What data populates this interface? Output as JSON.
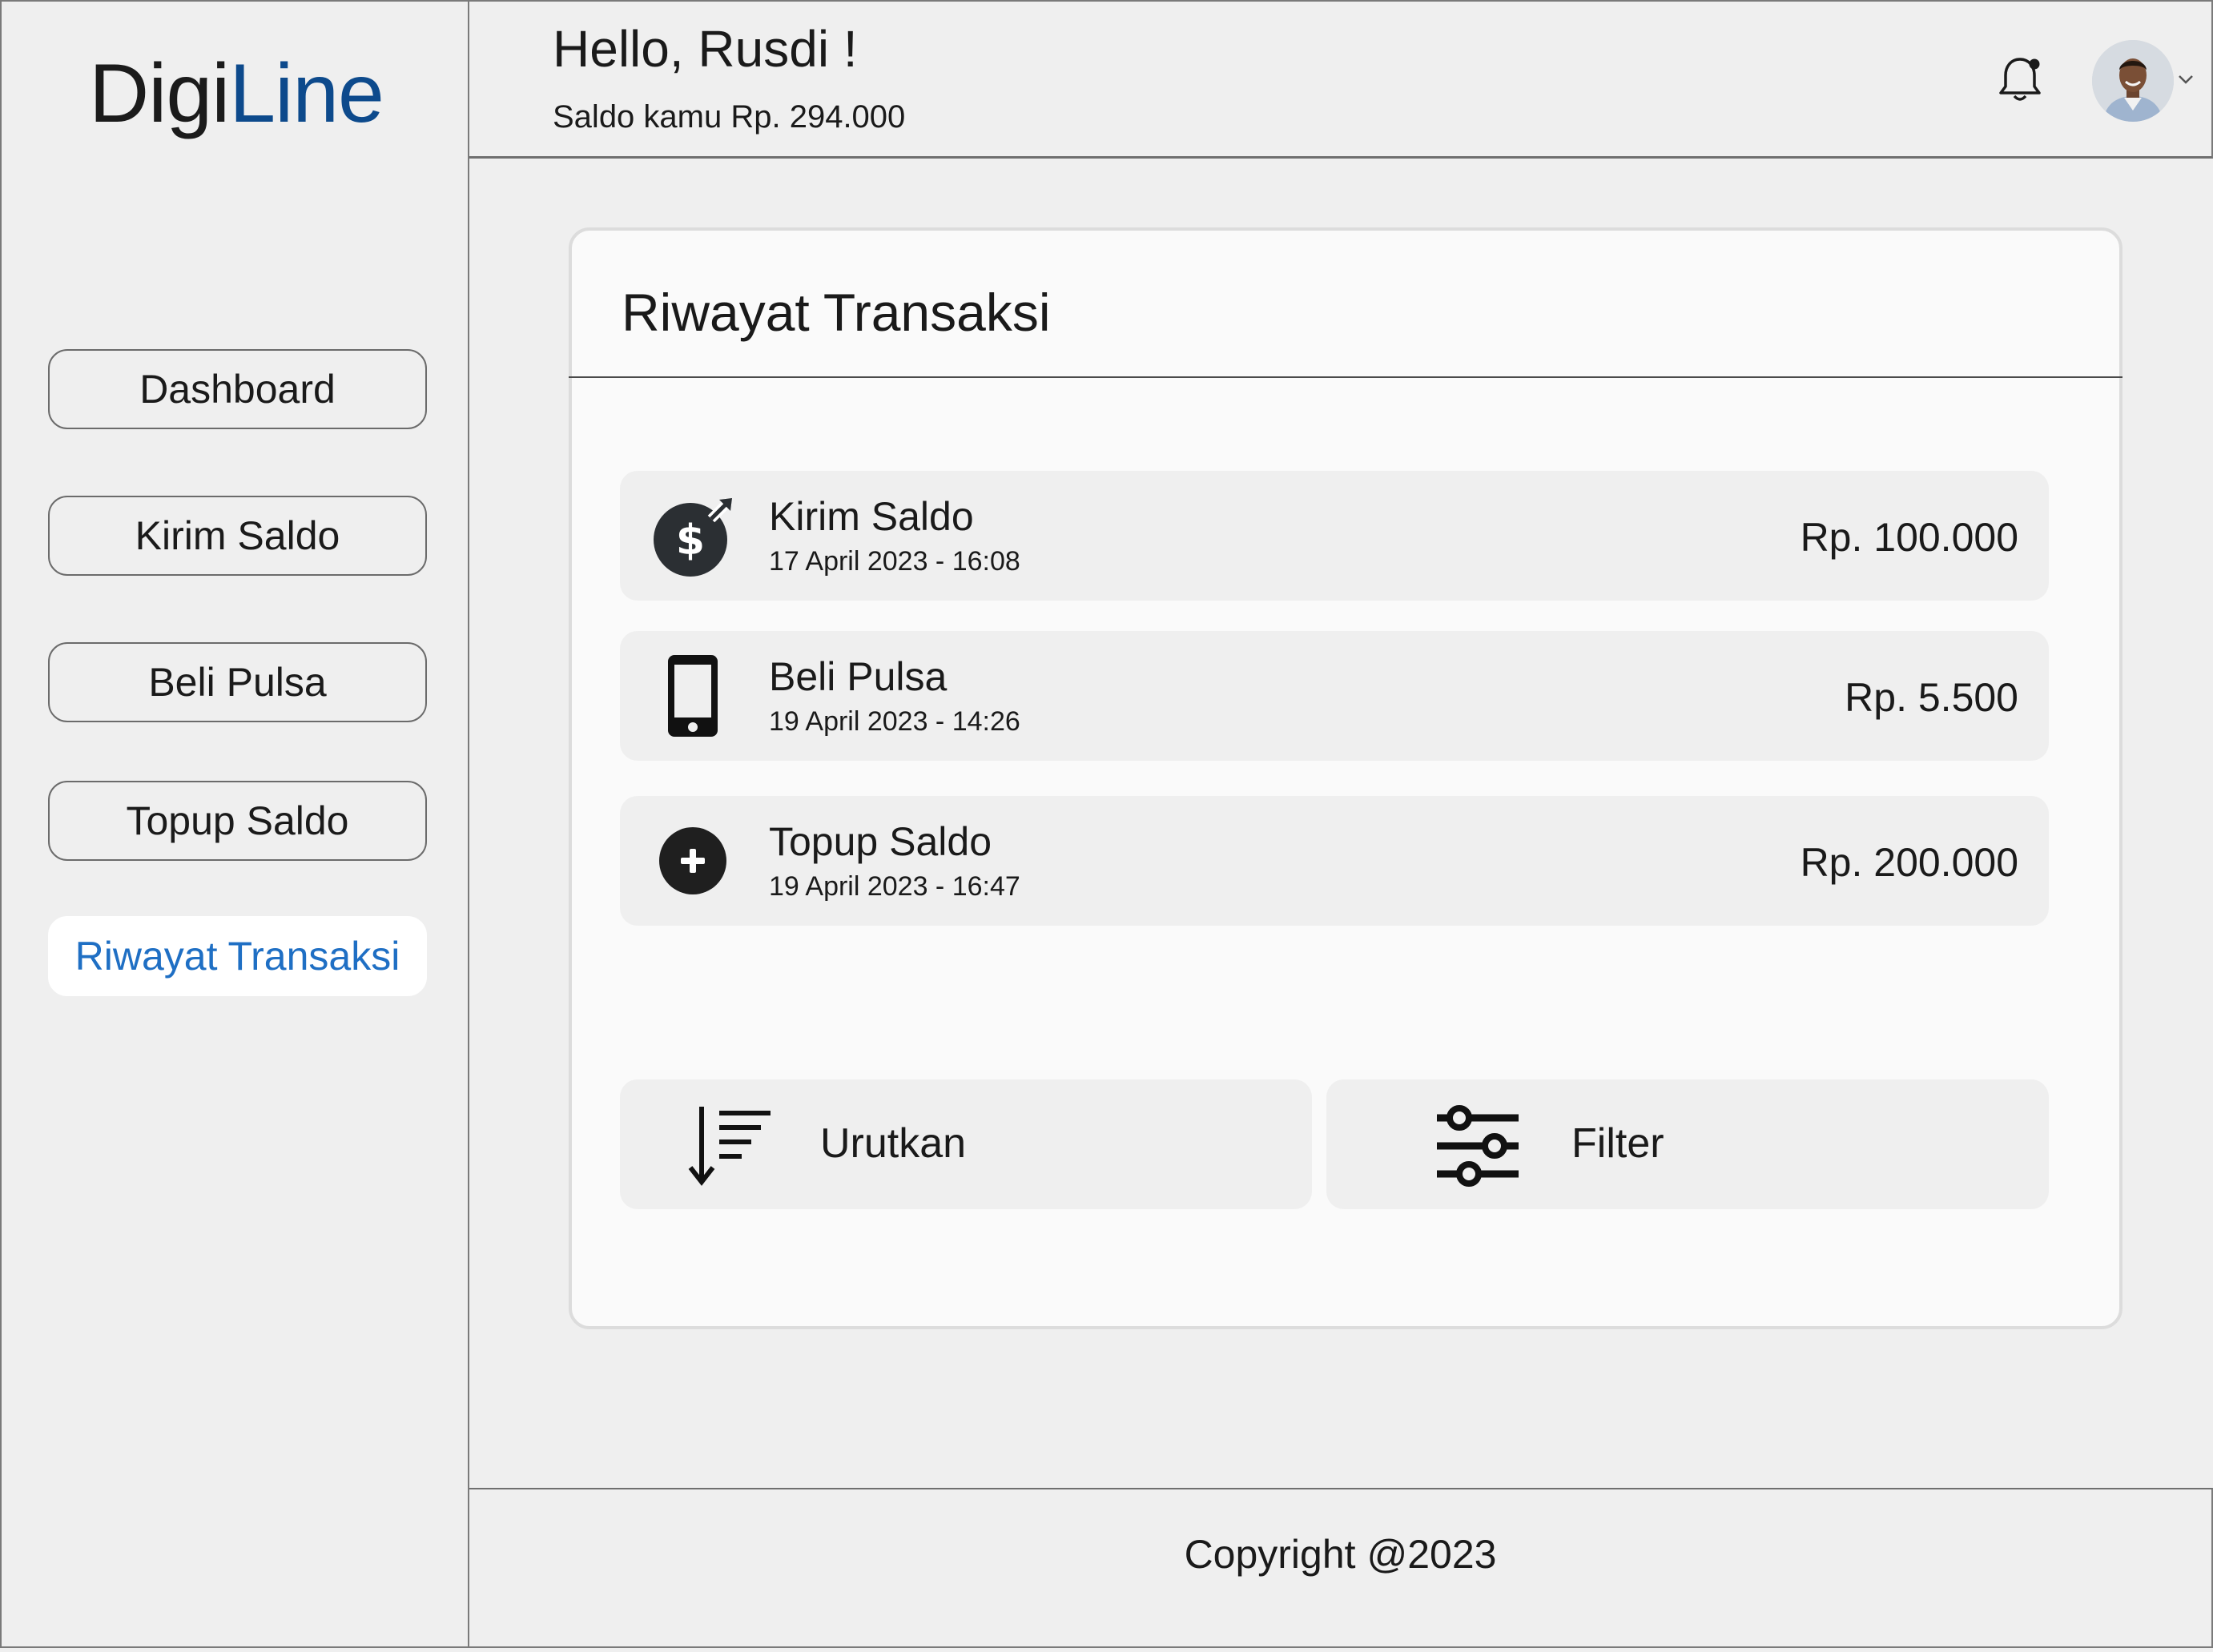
{
  "app": {
    "logo_part1": "Digi",
    "logo_part2": "Line",
    "logo_colors": [
      "#1b1b1b",
      "#0d4a8c"
    ]
  },
  "sidebar": {
    "items": [
      {
        "label": "Dashboard"
      },
      {
        "label": "Kirim Saldo"
      },
      {
        "label": "Beli Pulsa"
      },
      {
        "label": "Topup Saldo"
      },
      {
        "label": "Riwayat Transaksi",
        "active": true
      }
    ],
    "active_color": "#1f6fc4"
  },
  "header": {
    "greeting": "Hello, Rusdi !",
    "balance": "Saldo kamu Rp. 294.000",
    "icons": [
      "bell-icon",
      "avatar",
      "chevron-down-icon"
    ]
  },
  "card": {
    "title": "Riwayat Transaksi",
    "transactions": [
      {
        "name": "Kirim Saldo",
        "date": "17 April 2023 - 16:08",
        "amount": "Rp. 100.000",
        "icon": "send-money-icon"
      },
      {
        "name": "Beli Pulsa",
        "date": "19 April 2023 - 14:26",
        "amount": "Rp. 5.500",
        "icon": "phone-icon"
      },
      {
        "name": "Topup Saldo",
        "date": "19 April 2023 - 16:47",
        "amount": "Rp. 200.000",
        "icon": "plus-circle-icon"
      }
    ],
    "actions": {
      "sort_label": "Urutkan",
      "filter_label": "Filter"
    }
  },
  "footer": {
    "copyright": "Copyright @2023"
  }
}
